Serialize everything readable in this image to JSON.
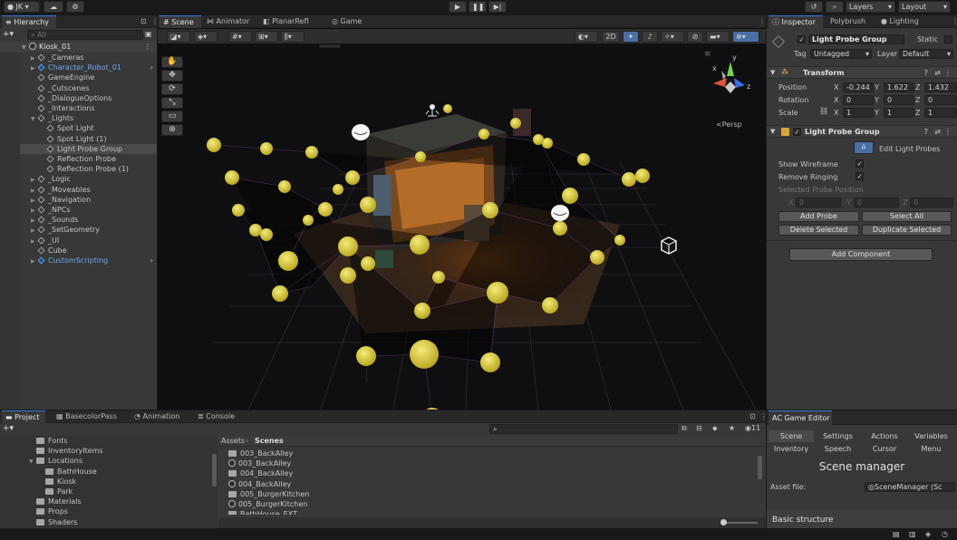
{
  "topbar": {
    "account": "JK",
    "layers": "Layers",
    "layout": "Layout"
  },
  "hierarchy": {
    "tab": "Hierarchy",
    "search_placeholder": "All",
    "root": "Kiosk_01",
    "items": [
      {
        "label": "_Cameras",
        "indent": 1,
        "arrow": "▶",
        "blue": false
      },
      {
        "label": "Character_Robot_01",
        "indent": 1,
        "arrow": "▶",
        "blue": true
      },
      {
        "label": "GameEngine",
        "indent": 1,
        "arrow": "",
        "blue": false
      },
      {
        "label": "_Cutscenes",
        "indent": 1,
        "arrow": "",
        "blue": false
      },
      {
        "label": "_DialogueOptions",
        "indent": 1,
        "arrow": "",
        "blue": false
      },
      {
        "label": "_Interactions",
        "indent": 1,
        "arrow": "",
        "blue": false
      },
      {
        "label": "_Lights",
        "indent": 1,
        "arrow": "▼",
        "blue": false
      },
      {
        "label": "Spot Light",
        "indent": 2,
        "arrow": "",
        "blue": false
      },
      {
        "label": "Spot Light (1)",
        "indent": 2,
        "arrow": "",
        "blue": false
      },
      {
        "label": "Light Probe Group",
        "indent": 2,
        "arrow": "",
        "blue": false,
        "selected": true
      },
      {
        "label": "Reflection Probe",
        "indent": 2,
        "arrow": "",
        "blue": false
      },
      {
        "label": "Reflection Probe (1)",
        "indent": 2,
        "arrow": "",
        "blue": false
      },
      {
        "label": "_Logic",
        "indent": 1,
        "arrow": "▶",
        "blue": false
      },
      {
        "label": "_Moveables",
        "indent": 1,
        "arrow": "▶",
        "blue": false
      },
      {
        "label": "_Navigation",
        "indent": 1,
        "arrow": "▶",
        "blue": false
      },
      {
        "label": "_NPCs",
        "indent": 1,
        "arrow": "▶",
        "blue": false
      },
      {
        "label": "_Sounds",
        "indent": 1,
        "arrow": "▶",
        "blue": false
      },
      {
        "label": "_SetGeometry",
        "indent": 1,
        "arrow": "▶",
        "blue": false
      },
      {
        "label": "_UI",
        "indent": 1,
        "arrow": "▶",
        "blue": false
      },
      {
        "label": "Cube",
        "indent": 1,
        "arrow": "",
        "blue": false
      },
      {
        "label": "CustomScripting",
        "indent": 1,
        "arrow": "▶",
        "blue": true
      }
    ]
  },
  "scene": {
    "tabs": [
      "Scene",
      "Animator",
      "PlanarRefl",
      "Game"
    ],
    "mode_2d": "2D",
    "persp": "<Persp",
    "gizmo": {
      "x": "x",
      "y": "y",
      "z": "z"
    }
  },
  "inspector": {
    "tabs": [
      "Inspector",
      "Polybrush",
      "Lighting"
    ],
    "object_name": "Light Probe Group",
    "static": "Static",
    "tag_label": "Tag",
    "tag_value": "Untagged",
    "layer_label": "Layer",
    "layer_value": "Default",
    "transform": {
      "title": "Transform",
      "rows": [
        {
          "label": "Position",
          "x": "-0.244",
          "y": "1.622",
          "z": "1.432"
        },
        {
          "label": "Rotation",
          "x": "0",
          "y": "0",
          "z": "0"
        },
        {
          "label": "Scale",
          "x": "1",
          "y": "1",
          "z": "1"
        }
      ],
      "axis": [
        "X",
        "Y",
        "Z"
      ]
    },
    "probe_group": {
      "title": "Light Probe Group",
      "edit_button": "Edit Light Probes",
      "show_wireframe": "Show Wireframe",
      "remove_ringing": "Remove Ringing",
      "selected_position": "Selected Probe Position",
      "sel_values": [
        "0",
        "0",
        "0"
      ],
      "add_probe": "Add Probe",
      "select_all": "Select All",
      "delete_selected": "Delete Selected",
      "duplicate_selected": "Duplicate Selected"
    },
    "add_component": "Add Component"
  },
  "project": {
    "tabs": [
      "Project",
      "BasecolorPass",
      "Animation",
      "Console"
    ],
    "tree": [
      {
        "label": "Fonts",
        "indent": 1
      },
      {
        "label": "InventoryItems",
        "indent": 1
      },
      {
        "label": "Locations",
        "indent": 1,
        "open": true
      },
      {
        "label": "BathHouse",
        "indent": 2
      },
      {
        "label": "Kiosk",
        "indent": 2
      },
      {
        "label": "Park",
        "indent": 2
      },
      {
        "label": "Materials",
        "indent": 1
      },
      {
        "label": "Props",
        "indent": 1
      },
      {
        "label": "Shaders",
        "indent": 1
      }
    ],
    "breadcrumb": [
      "Assets",
      "Scenes"
    ],
    "count": "11",
    "files": [
      {
        "label": "003_BackAlley",
        "type": "folder"
      },
      {
        "label": "003_BackAlley",
        "type": "unity"
      },
      {
        "label": "004_BackAlley",
        "type": "folder"
      },
      {
        "label": "004_BackAlley",
        "type": "unity"
      },
      {
        "label": "005_BurgerKitchen",
        "type": "folder"
      },
      {
        "label": "005_BurgerKitchen",
        "type": "unity"
      },
      {
        "label": "BathHouse_EXT",
        "type": "folder"
      }
    ]
  },
  "ac_editor": {
    "tab": "AC Game Editor",
    "tabs_row1": [
      "Scene",
      "Settings",
      "Actions",
      "Variables"
    ],
    "tabs_row2": [
      "Inventory",
      "Speech",
      "Cursor",
      "Menu"
    ],
    "title": "Scene manager",
    "asset_label": "Asset file:",
    "asset_value": "SceneManager (Sc",
    "section": "Basic structure"
  }
}
